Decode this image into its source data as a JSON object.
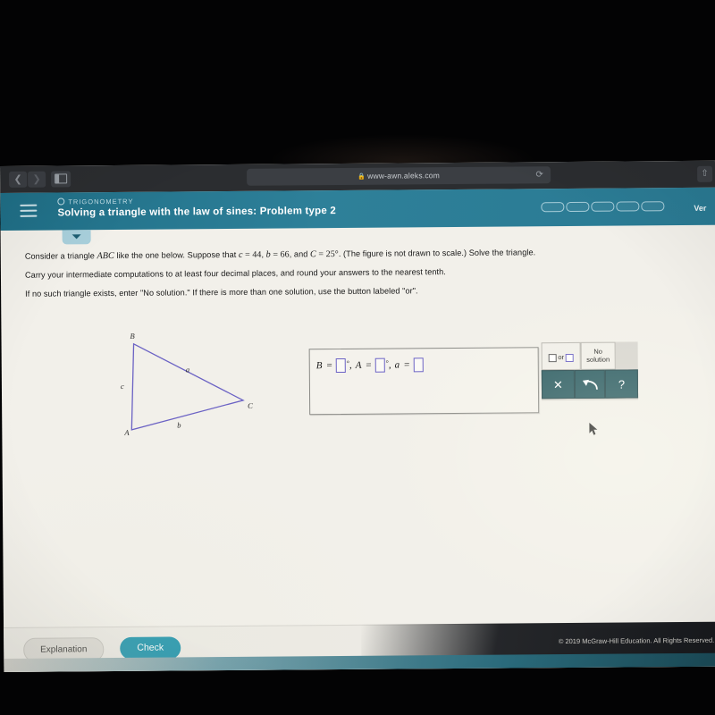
{
  "browser": {
    "back_icon": "chevron-left-icon",
    "forward_icon": "chevron-right-icon",
    "sidebar_icon": "sidebar-toggle-icon",
    "url": "www-awn.aleks.com",
    "lock_icon": "lock-icon",
    "reload_icon": "reload-icon",
    "share_icon": "share-icon"
  },
  "header": {
    "menu_icon": "hamburger-menu-icon",
    "course_label": "TRIGONOMETRY",
    "course_icon": "circle-icon",
    "title": "Solving a triangle with the law of sines: Problem type 2",
    "progress_segments": 5,
    "right_label": "Ver",
    "dropdown_icon": "chevron-down-icon",
    "accent_color": "#2a7a93"
  },
  "problem": {
    "line1_a": "Consider a triangle ",
    "line1_abc": "ABC",
    "line1_b": " like the one below. Suppose that ",
    "line1_c_var": "c",
    "line1_c_eq": " = 44",
    "line1_sep1": ", ",
    "line1_b_var": "b",
    "line1_b_eq": " = 66",
    "line1_sep2": ", and ",
    "line1_C_var": "C",
    "line1_C_eq": " = 25°",
    "line1_end": ". (The figure is not drawn to scale.) Solve the triangle.",
    "line2": "Carry your intermediate computations to at least four decimal places, and round your answers to the nearest tenth.",
    "line3": "If no such triangle exists, enter \"No solution.\" If there is more than one solution, use the button labeled \"or\"."
  },
  "figure": {
    "vertex_B": "B",
    "vertex_A": "A",
    "vertex_C": "C",
    "side_a": "a",
    "side_b": "b",
    "side_c": "c",
    "stroke_color": "#6b62c4"
  },
  "answer": {
    "var_B": "B",
    "var_A": "A",
    "var_a": "a",
    "equals": "=",
    "degree": "°",
    "comma": ",",
    "value_B": "",
    "value_A": "",
    "value_a": ""
  },
  "keypad": {
    "or_label": "or",
    "no_solution_label": "No solution",
    "clear_icon": "clear-x-icon",
    "clear_glyph": "✕",
    "undo_icon": "undo-arrow-icon",
    "help_icon": "help-question-icon",
    "help_glyph": "?"
  },
  "footer": {
    "explanation_label": "Explanation",
    "check_label": "Check",
    "check_color": "#1d93ab",
    "copyright": "© 2019 McGraw-Hill Education. All Rights Reserved."
  },
  "cursor": {
    "icon": "mouse-pointer-icon"
  }
}
